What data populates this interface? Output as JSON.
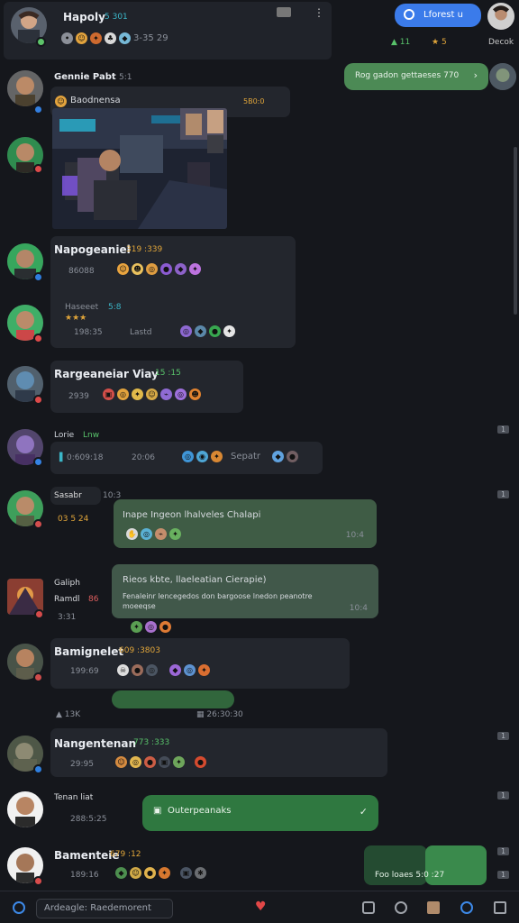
{
  "top": {
    "profile_name": "Hapoly",
    "profile_tag": "5 301",
    "counts": "3-35  29",
    "tag_icon": "tag-icon",
    "menu_icon": "more-vertical-icon",
    "search_button": "Lforest u",
    "right_counts": [
      "11",
      "5",
      "Decok"
    ]
  },
  "messages": [
    {
      "name": "Gennie Pabt",
      "tag": "5:1",
      "line": "Baodnensa",
      "line_extra": "5B0:0",
      "image_alt": "arcade-scene"
    },
    {
      "name": "Napogeaniel",
      "tag": "319 :339",
      "line": "86088",
      "line2": "Haseeet",
      "line2_tag": "5:8",
      "line3": "198:35",
      "line3_extra": "Lastd"
    },
    {
      "name": "Rargeaneiar Viay",
      "tag": "15 :15",
      "line": "2939"
    },
    {
      "name": "Lorie",
      "tag": "Lnw",
      "line": "0:609:18",
      "line_extra": "20:06",
      "line_note": "Sepatr"
    },
    {
      "name": "Sasabr",
      "tag": "10:3",
      "line": "03 5 24"
    },
    {
      "name": "Galiph",
      "tag": "86",
      "line": "Ramdl",
      "line2": "3:31"
    },
    {
      "name": "Bamignelet",
      "tag": "609 :3803",
      "line": "199:69"
    },
    {
      "name": "Nangentenan",
      "tag": "773 :333",
      "line": "29:95"
    },
    {
      "name": "Tenan liat",
      "tag": "",
      "line": "288:5:25"
    },
    {
      "name": "Bamenteie",
      "tag": "679 :12",
      "line": "189:16"
    }
  ],
  "green_messages": [
    {
      "text": "Rog gadon gettaeses 770"
    },
    {
      "text": "Inape Ingeon lhalveles Chalapi"
    },
    {
      "text": "Rieos kbte, llaeleatian Cierapie)"
    },
    {
      "text": "Fenaleinr lencegedos don bargoose lnedon peanotre",
      "sub": "moeeqse"
    },
    {
      "text": "Outerpeanaks"
    },
    {
      "text": "Foo loaes  5:0 :27"
    }
  ],
  "unreads": [
    "1",
    "1",
    "1",
    "1",
    "1",
    "1"
  ],
  "bottom": {
    "input_value": "Ardeagle: Raedemorent",
    "icons": [
      "refresh-icon",
      "heart-icon",
      "note-icon",
      "chat-icon",
      "photo-icon",
      "globe-icon",
      "screen-icon"
    ]
  }
}
